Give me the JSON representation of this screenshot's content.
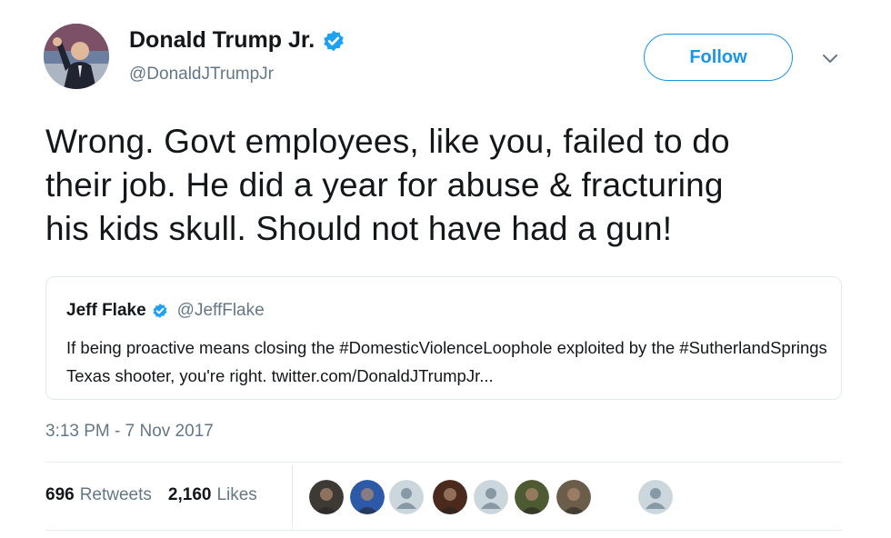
{
  "author": {
    "name": "Donald Trump Jr.",
    "handle": "@DonaldJTrumpJr",
    "verified_icon": "verified-badge-icon"
  },
  "actions": {
    "follow_label": "Follow",
    "more_icon": "chevron-down-icon"
  },
  "tweet": {
    "text": "Wrong. Govt employees, like you, failed to do\ntheir job. He did a year for abuse & fracturing\nhis kids skull. Should not have had a gun!",
    "timestamp": "3:13 PM - 7 Nov 2017"
  },
  "quoted_tweet": {
    "name": "Jeff Flake",
    "handle": "@JeffFlake",
    "text": "If being proactive means closing the #DomesticViolenceLoophole exploited by the #SutherlandSprings Texas shooter, you're right. twitter.com/DonaldJTrumpJr..."
  },
  "stats": {
    "retweets_count": "696",
    "retweets_label": "Retweets",
    "likes_count": "2,160",
    "likes_label": "Likes"
  },
  "likers": [
    {
      "kind": "photo",
      "color": "#3d3a36"
    },
    {
      "kind": "photo",
      "color": "#2c5aa8"
    },
    {
      "kind": "default",
      "color": "#ccd6dd"
    },
    {
      "kind": "photo",
      "color": "#4a2a1c"
    },
    {
      "kind": "default",
      "color": "#ccd6dd"
    },
    {
      "kind": "photo",
      "color": "#4e5a32"
    },
    {
      "kind": "photo",
      "color": "#6a5e4a"
    },
    {
      "kind": "default",
      "color": "#ccd6dd"
    }
  ],
  "colors": {
    "accent": "#1b95e0",
    "verified": "#1da1f2",
    "secondary_text": "#657786",
    "divider": "#e6ecf0"
  }
}
